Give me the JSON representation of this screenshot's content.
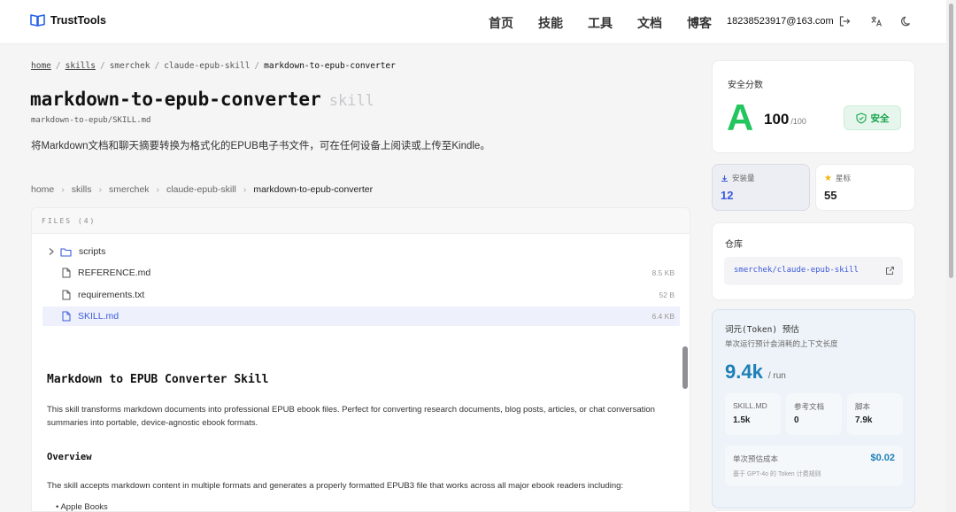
{
  "header": {
    "brand": "TrustTools",
    "nav": [
      "首页",
      "技能",
      "工具",
      "文档",
      "博客"
    ],
    "email": "18238523917@163.com"
  },
  "breadcrumb_top": {
    "items": [
      "home",
      "skills",
      "smerchek",
      "claude-epub-skill"
    ],
    "current": "markdown-to-epub-converter"
  },
  "page": {
    "title": "markdown-to-epub-converter",
    "badge": "skill",
    "path": "markdown-to-epub/SKILL.md",
    "description": "将Markdown文档和聊天摘要转换为格式化的EPUB电子书文件，可在任何设备上阅读或上传至Kindle。"
  },
  "breadcrumb_second": {
    "items": [
      "home",
      "skills",
      "smerchek",
      "claude-epub-skill"
    ],
    "current": "markdown-to-epub-converter"
  },
  "files": {
    "header": "FILES (4)",
    "entries": [
      {
        "name": "scripts",
        "type": "folder",
        "size": ""
      },
      {
        "name": "REFERENCE.md",
        "type": "file",
        "size": "8.5 KB"
      },
      {
        "name": "requirements.txt",
        "type": "file",
        "size": "52 B"
      },
      {
        "name": "SKILL.md",
        "type": "file",
        "size": "6.4 KB",
        "selected": true
      }
    ]
  },
  "markdown": {
    "h1": "Markdown to EPUB Converter Skill",
    "p1": "This skill transforms markdown documents into professional EPUB ebook files. Perfect for converting research documents, blog posts, articles, or chat conversation summaries into portable, device-agnostic ebook formats.",
    "h2": "Overview",
    "p2": "The skill accepts markdown content in multiple formats and generates a properly formatted EPUB3 file that works across all major ebook readers including:",
    "li1": "Apple Books"
  },
  "security": {
    "label": "安全分数",
    "grade": "A",
    "score": "100",
    "max": "/100",
    "status": "安全",
    "grade_color": "#22c55e"
  },
  "stats": {
    "installs_label": "安装量",
    "installs": "12",
    "stars_label": "星标",
    "stars": "55"
  },
  "repo": {
    "label": "仓库",
    "name": "smerchek/claude-epub-skill"
  },
  "tokens": {
    "title": "词元(Token) 预估",
    "subtitle": "单次运行预计会消耗的上下文长度",
    "value": "9.4k",
    "unit": "/ run",
    "breakdown": [
      {
        "label": "SKILL.MD",
        "value": "1.5k"
      },
      {
        "label": "参考文档",
        "value": "0"
      },
      {
        "label": "脚本",
        "value": "7.9k"
      }
    ],
    "cost_label": "单次预估成本",
    "cost_value": "$0.02",
    "cost_note": "基于 GPT-4o 的 Token 计费规则",
    "accent": "#1e7fb8"
  }
}
